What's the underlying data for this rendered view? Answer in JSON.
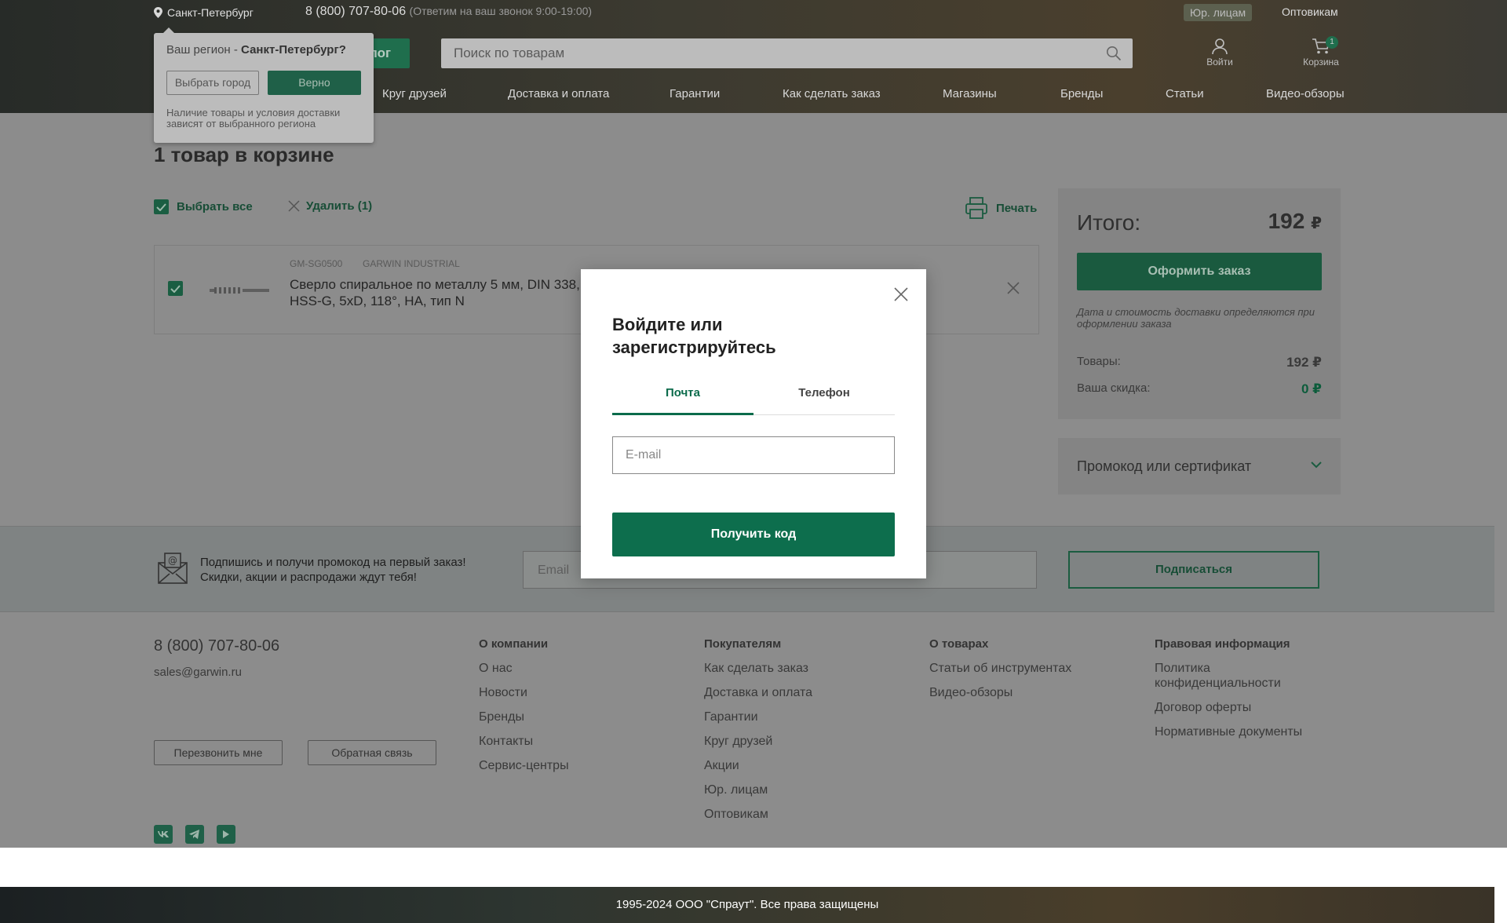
{
  "header": {
    "city": "Санкт-Петербург",
    "phone": "8 (800) 707-80-06",
    "hours": "(Ответим на ваш звонок 9:00-19:00)",
    "jur_label": "Юр. лицам",
    "wholesale_label": "Оптовикам",
    "catalog_label": "лог",
    "search_placeholder": "Поиск по товарам",
    "login_label": "Войти",
    "cart_label": "Корзина",
    "cart_count": "1",
    "nav": [
      "Круг друзей",
      "Доставка и оплата",
      "Гарантии",
      "Как сделать заказ",
      "Магазины",
      "Бренды",
      "Статьи",
      "Видео-обзоры"
    ]
  },
  "region_popup": {
    "question_prefix": "Ваш регион - ",
    "question_city": "Санкт-Петербург?",
    "choose_label": "Выбрать город",
    "confirm_label": "Верно",
    "note": "Наличие товары и условия доставки зависят от выбранного региона"
  },
  "cart": {
    "title": "1 товар в корзине",
    "select_all": "Выбрать все",
    "delete_label": "Удалить (1)",
    "print_label": "Печать",
    "items": [
      {
        "sku": "GM-SG0500",
        "brand": "GARWIN INDUSTRIAL",
        "name": "Сверло спиральное по металлу 5 мм, DIN 338, HSS-G, 5xD, 118°, HA, тип N"
      }
    ]
  },
  "summary": {
    "total_label": "Итого:",
    "total_value": "192",
    "currency": "₽",
    "order_button": "Оформить заказ",
    "note": "Дата и стоимость доставки определяются при оформлении заказа",
    "goods_label": "Товары:",
    "goods_value": "192 ₽",
    "discount_label": "Ваша скидка:",
    "discount_value": "0 ₽",
    "promo_label": "Промокод или сертификат"
  },
  "newsletter": {
    "line1": "Подпишись и получи промокод на первый заказ!",
    "line2": "Скидки, акции и распродажи ждут тебя!",
    "placeholder": "Email",
    "button": "Подписаться"
  },
  "footer": {
    "phone": "8 (800) 707-80-06",
    "email": "sales@garwin.ru",
    "callback_button": "Перезвонить мне",
    "feedback_button": "Обратная связь",
    "columns": [
      {
        "title": "О компании",
        "links": [
          "О нас",
          "Новости",
          "Бренды",
          "Контакты",
          "Сервис-центры"
        ]
      },
      {
        "title": "Покупателям",
        "links": [
          "Как сделать заказ",
          "Доставка и оплата",
          "Гарантии",
          "Круг друзей",
          "Акции",
          "Юр. лицам",
          "Оптовикам"
        ]
      },
      {
        "title": "О товарах",
        "links": [
          "Статьи об инструментах",
          "Видео-обзоры"
        ]
      },
      {
        "title": "Правовая информация",
        "links": [
          "Политика конфиденциальности",
          "Договор оферты",
          "Нормативные документы"
        ]
      }
    ],
    "social": [
      "vk-icon",
      "telegram-icon",
      "youtube-icon"
    ],
    "copyright": "1995-2024 ООО \"Спраут\". Все права защищены"
  },
  "modal": {
    "title": "Войдите или зарегистрируйтесь",
    "tab_email": "Почта",
    "tab_phone": "Телефон",
    "email_placeholder": "E-mail",
    "submit": "Получить код"
  },
  "colors": {
    "brand_green": "#0d6e4d",
    "overlay_gray": "#8c8c8c"
  }
}
